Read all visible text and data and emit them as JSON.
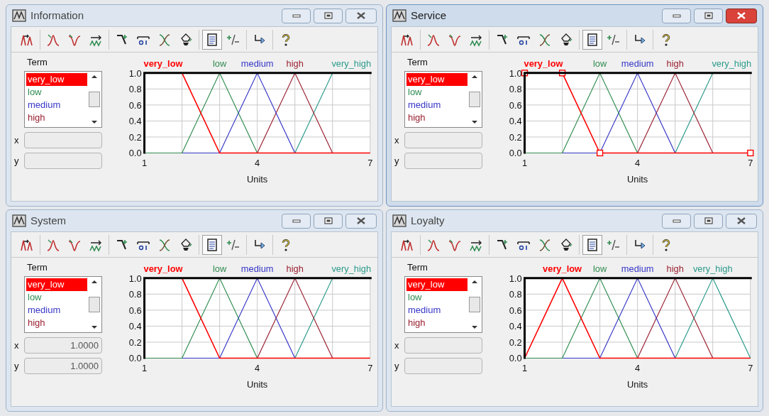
{
  "windows": [
    {
      "title": "Information",
      "active": false,
      "points_shown": false,
      "view_toggle_on": true,
      "term_label": "Term",
      "terms": [
        {
          "name": "very_low",
          "color": "#ff0000",
          "selected": true
        },
        {
          "name": "low",
          "color": "#2e8b4e",
          "selected": false
        },
        {
          "name": "medium",
          "color": "#3535c8",
          "selected": false
        },
        {
          "name": "high",
          "color": "#9a2030",
          "selected": false
        }
      ],
      "x_field": {
        "label": "x"
      },
      "y_field": {
        "label": "y"
      },
      "chart_data": {
        "type": "line",
        "xlabel": "Units",
        "x": [
          1,
          2,
          3,
          4,
          5,
          6,
          7
        ],
        "xlim": [
          1,
          7
        ],
        "ylim": [
          0,
          1
        ],
        "xticks": [
          1,
          4,
          7
        ],
        "yticks": [
          {
            "value": 0,
            "label": "0.0"
          },
          {
            "value": 0.2,
            "label": "0.2"
          },
          {
            "value": 0.4,
            "label": "0.4"
          },
          {
            "value": 0.6,
            "label": "0.6"
          },
          {
            "value": 0.8,
            "label": "0.8"
          },
          {
            "value": 1,
            "label": "1.0"
          }
        ],
        "series": [
          {
            "name": "very_low",
            "color": "#ff0000",
            "values": [
              1,
              1,
              0,
              0,
              0,
              0,
              0
            ]
          },
          {
            "name": "low",
            "color": "#2e8b4e",
            "values": [
              0,
              0,
              1,
              0,
              null,
              null,
              null
            ]
          },
          {
            "name": "medium",
            "color": "#3535c8",
            "values": [
              null,
              0,
              0,
              1,
              0,
              null,
              null
            ]
          },
          {
            "name": "high",
            "color": "#9a2030",
            "values": [
              null,
              null,
              null,
              0,
              1,
              0,
              null
            ]
          },
          {
            "name": "very_high",
            "color": "#2a9a8a",
            "values": [
              null,
              null,
              null,
              null,
              0,
              1,
              1
            ]
          }
        ],
        "grid": true
      }
    },
    {
      "title": "Service",
      "active": true,
      "points_shown": true,
      "view_toggle_on": true,
      "term_label": "Term",
      "terms": [
        {
          "name": "very_low",
          "color": "#ff0000",
          "selected": true
        },
        {
          "name": "low",
          "color": "#2e8b4e",
          "selected": false
        },
        {
          "name": "medium",
          "color": "#3535c8",
          "selected": false
        },
        {
          "name": "high",
          "color": "#9a2030",
          "selected": false
        }
      ],
      "x_field": {
        "label": "x"
      },
      "y_field": {
        "label": "y"
      },
      "chart_data": {
        "type": "line",
        "xlabel": "Units",
        "x": [
          1,
          2,
          3,
          4,
          5,
          6,
          7
        ],
        "xlim": [
          1,
          7
        ],
        "ylim": [
          0,
          1
        ],
        "xticks": [
          1,
          4,
          7
        ],
        "yticks": [
          {
            "value": 0,
            "label": "0.0"
          },
          {
            "value": 0.2,
            "label": "0.2"
          },
          {
            "value": 0.4,
            "label": "0.4"
          },
          {
            "value": 0.6,
            "label": "0.6"
          },
          {
            "value": 0.8,
            "label": "0.8"
          },
          {
            "value": 1,
            "label": "1.0"
          }
        ],
        "series": [
          {
            "name": "very_low",
            "color": "#ff0000",
            "values": [
              1,
              1,
              0,
              0,
              0,
              0,
              0
            ]
          },
          {
            "name": "low",
            "color": "#2e8b4e",
            "values": [
              0,
              0,
              1,
              0,
              null,
              null,
              null
            ]
          },
          {
            "name": "medium",
            "color": "#3535c8",
            "values": [
              null,
              0,
              0,
              1,
              0,
              null,
              null
            ]
          },
          {
            "name": "high",
            "color": "#9a2030",
            "values": [
              null,
              null,
              null,
              0,
              1,
              0,
              null
            ]
          },
          {
            "name": "very_high",
            "color": "#2a9a8a",
            "values": [
              null,
              null,
              null,
              null,
              0,
              1,
              1
            ]
          }
        ],
        "grid": true
      }
    },
    {
      "title": "System",
      "active": false,
      "points_shown": false,
      "view_toggle_on": true,
      "term_label": "Term",
      "terms": [
        {
          "name": "very_low",
          "color": "#ff0000",
          "selected": true
        },
        {
          "name": "low",
          "color": "#2e8b4e",
          "selected": false
        },
        {
          "name": "medium",
          "color": "#3535c8",
          "selected": false
        },
        {
          "name": "high",
          "color": "#9a2030",
          "selected": false
        }
      ],
      "x_field": {
        "label": "x",
        "value": "1.0000"
      },
      "y_field": {
        "label": "y",
        "value": "1.0000"
      },
      "chart_data": {
        "type": "line",
        "xlabel": "Units",
        "x": [
          1,
          2,
          3,
          4,
          5,
          6,
          7
        ],
        "xlim": [
          1,
          7
        ],
        "ylim": [
          0,
          1
        ],
        "xticks": [
          1,
          4,
          7
        ],
        "yticks": [
          {
            "value": 0,
            "label": "0.0"
          },
          {
            "value": 0.2,
            "label": "0.2"
          },
          {
            "value": 0.4,
            "label": "0.4"
          },
          {
            "value": 0.6,
            "label": "0.6"
          },
          {
            "value": 0.8,
            "label": "0.8"
          },
          {
            "value": 1,
            "label": "1.0"
          }
        ],
        "series": [
          {
            "name": "very_low",
            "color": "#ff0000",
            "values": [
              1,
              1,
              0,
              0,
              0,
              0,
              0
            ]
          },
          {
            "name": "low",
            "color": "#2e8b4e",
            "values": [
              0,
              0,
              1,
              0,
              null,
              null,
              null
            ]
          },
          {
            "name": "medium",
            "color": "#3535c8",
            "values": [
              null,
              0,
              0,
              1,
              0,
              null,
              null
            ]
          },
          {
            "name": "high",
            "color": "#9a2030",
            "values": [
              null,
              null,
              null,
              0,
              1,
              0,
              null
            ]
          },
          {
            "name": "very_high",
            "color": "#2a9a8a",
            "values": [
              null,
              null,
              null,
              null,
              0,
              1,
              1
            ]
          }
        ],
        "grid": true
      }
    },
    {
      "title": "Loyalty",
      "active": false,
      "points_shown": false,
      "view_toggle_on": true,
      "term_label": "Term",
      "terms": [
        {
          "name": "very_low",
          "color": "#ff0000",
          "selected": true
        },
        {
          "name": "low",
          "color": "#2e8b4e",
          "selected": false
        },
        {
          "name": "medium",
          "color": "#3535c8",
          "selected": false
        },
        {
          "name": "high",
          "color": "#9a2030",
          "selected": false
        }
      ],
      "x_field": {
        "label": "x"
      },
      "y_field": {
        "label": "y"
      },
      "chart_data": {
        "type": "line",
        "xlabel": "Units",
        "x": [
          1,
          2,
          3,
          4,
          5,
          6,
          7
        ],
        "xlim": [
          1,
          7
        ],
        "ylim": [
          0,
          1
        ],
        "xticks": [
          1,
          4,
          7
        ],
        "yticks": [
          {
            "value": 0,
            "label": "0.0"
          },
          {
            "value": 0.2,
            "label": "0.2"
          },
          {
            "value": 0.4,
            "label": "0.4"
          },
          {
            "value": 0.6,
            "label": "0.6"
          },
          {
            "value": 0.8,
            "label": "0.8"
          },
          {
            "value": 1,
            "label": "1.0"
          }
        ],
        "series": [
          {
            "name": "very_low",
            "color": "#ff0000",
            "values": [
              0,
              1,
              0,
              0,
              0,
              0,
              0
            ]
          },
          {
            "name": "low",
            "color": "#2e8b4e",
            "values": [
              0,
              0,
              1,
              0,
              null,
              null,
              null
            ]
          },
          {
            "name": "medium",
            "color": "#3535c8",
            "values": [
              null,
              0,
              0,
              1,
              0,
              null,
              null
            ]
          },
          {
            "name": "high",
            "color": "#9a2030",
            "values": [
              null,
              null,
              null,
              0,
              1,
              0,
              null
            ]
          },
          {
            "name": "very_high",
            "color": "#2a9a8a",
            "values": [
              null,
              null,
              null,
              null,
              0,
              1,
              0
            ]
          }
        ],
        "grid": true
      }
    }
  ]
}
